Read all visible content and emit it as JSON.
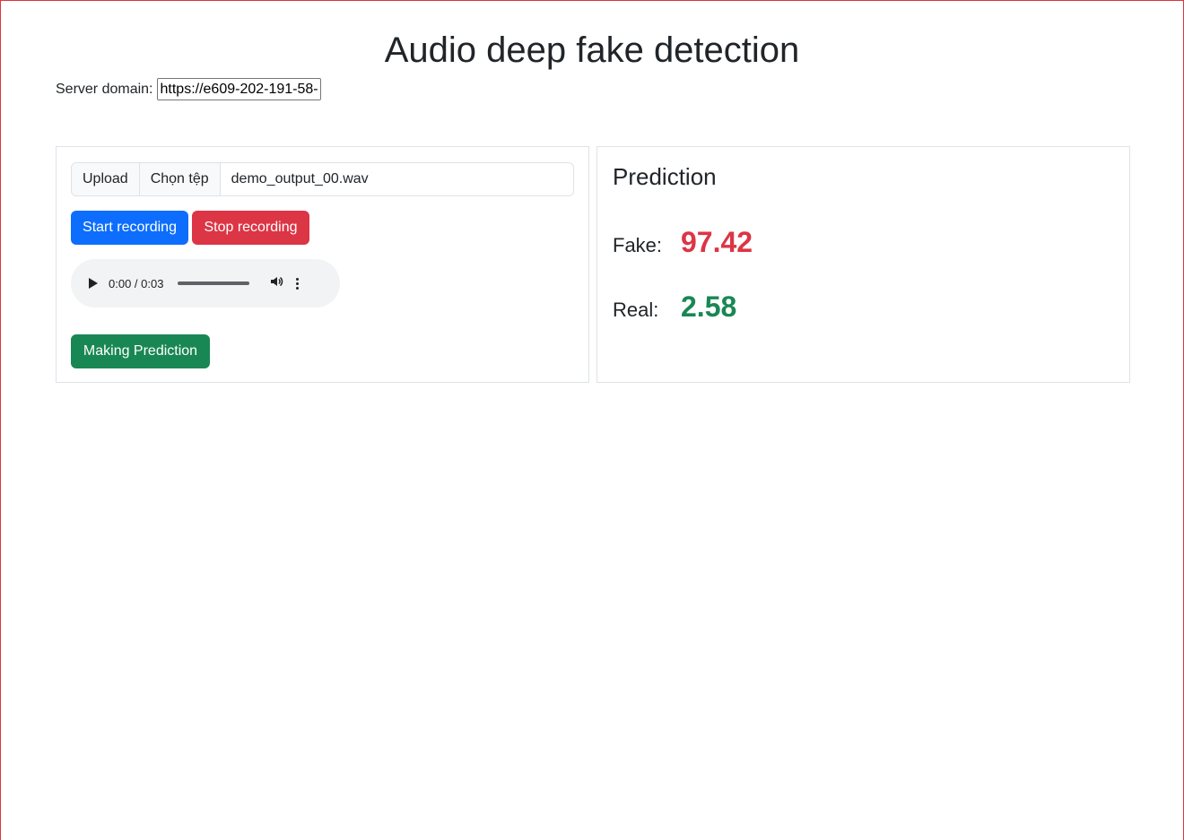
{
  "page": {
    "title": "Audio deep fake detection"
  },
  "server": {
    "label": "Server domain:",
    "value": "https://e609-202-191-58-"
  },
  "upload": {
    "addon_label": "Upload",
    "choose_label": "Chọn tệp",
    "filename": "demo_output_00.wav"
  },
  "recording": {
    "start_label": "Start recording",
    "stop_label": "Stop recording"
  },
  "audio": {
    "time": "0:00 / 0:03",
    "icons": [
      "play-icon",
      "volume-icon",
      "more-options-icon"
    ]
  },
  "predict_button": {
    "label": "Making Prediction"
  },
  "prediction": {
    "title": "Prediction",
    "fake_label": "Fake:",
    "fake_value": "97.42",
    "real_label": "Real:",
    "real_value": "2.58",
    "colors": {
      "fake": "#dc3545",
      "real": "#198754"
    }
  },
  "colors": {
    "primary": "#0d6efd",
    "danger": "#dc3545",
    "success": "#198754"
  }
}
